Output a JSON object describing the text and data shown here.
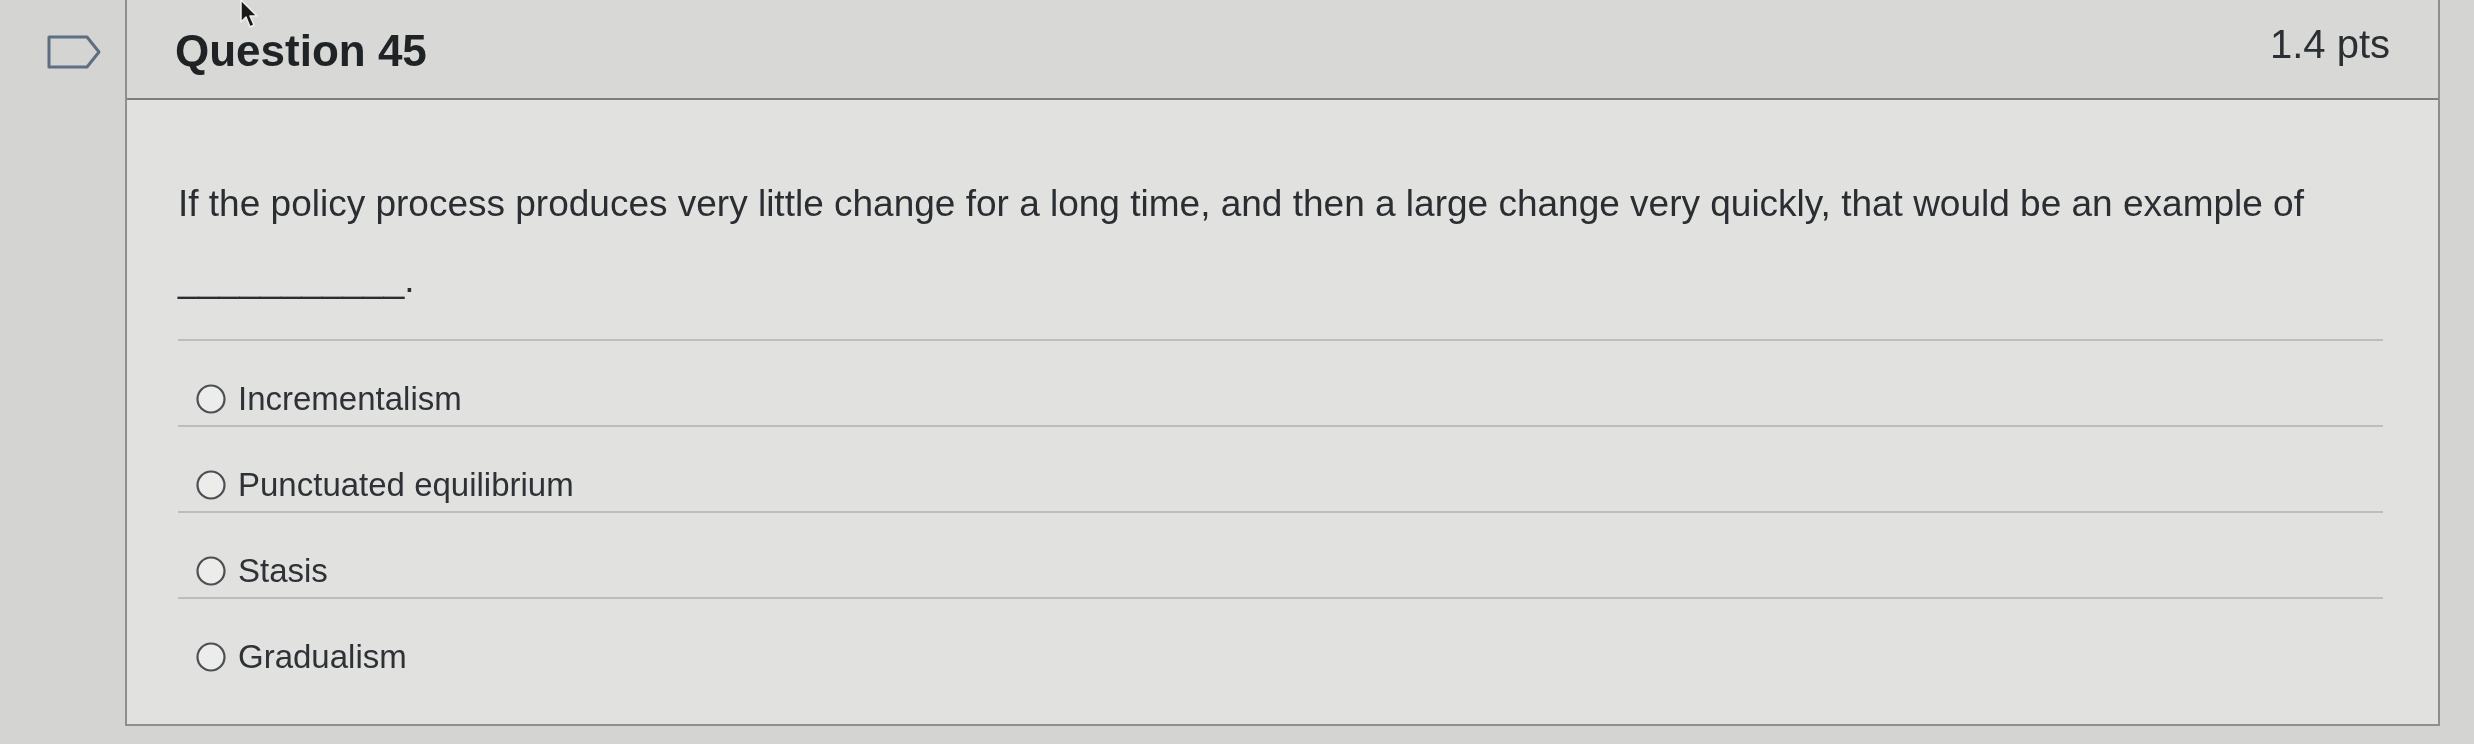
{
  "question": {
    "flagged": false,
    "title": "Question 45",
    "points": "1.4 pts",
    "text": "If the policy process produces very little change for a long time, and then a large change very quickly, that would be an example of",
    "blank": "___________.",
    "options": [
      {
        "label": "Incrementalism",
        "selected": false
      },
      {
        "label": "Punctuated equilibrium",
        "selected": false
      },
      {
        "label": "Stasis",
        "selected": false
      },
      {
        "label": "Gradualism",
        "selected": false
      }
    ]
  }
}
